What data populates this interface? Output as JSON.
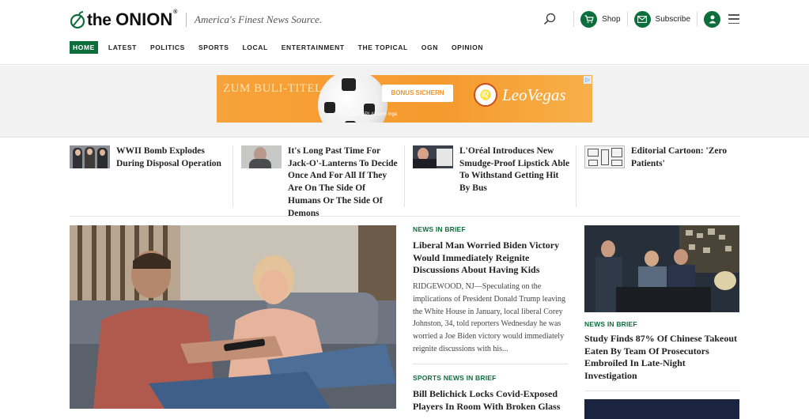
{
  "brand": {
    "logo_the": "the",
    "logo_onion": "ONION",
    "logo_reg": "®",
    "tagline": "America's Finest News Source.",
    "accent_color": "#0d6d3b"
  },
  "nav": {
    "items": [
      "HOME",
      "LATEST",
      "POLITICS",
      "SPORTS",
      "LOCAL",
      "ENTERTAINMENT",
      "THE TOPICAL",
      "OGN",
      "OPINION"
    ],
    "active": "HOME"
  },
  "header_actions": {
    "shop_label": "Shop",
    "subscribe_label": "Subscribe",
    "icons": [
      "search-icon",
      "cart-icon",
      "mail-icon",
      "user-icon",
      "menu-icon"
    ]
  },
  "ad": {
    "headline": "ZUM BULI-TITEL WETTEN",
    "button": "BONUS SICHERN",
    "brand": "LeoVegas",
    "footer": "LEOSAFEPLAY.com  mga"
  },
  "strip": [
    {
      "title": "WWII Bomb Explodes During Disposal Operation"
    },
    {
      "title": "It's Long Past Time For Jack-O'-Lanterns To Decide Once And For All If They Are On The Side Of Humans Or The Side Of Demons"
    },
    {
      "title": "L'Oréal Introduces New Smudge-Proof Lipstick Able To Withstand Getting Hit By Bus"
    },
    {
      "title": "Editorial Cartoon: 'Zero Patients'"
    }
  ],
  "center": {
    "kicker": "NEWS IN BRIEF",
    "headline": "Liberal Man Worried Biden Victory Would Immediately Reignite Discussions About Having Kids",
    "body": "RIDGEWOOD, NJ—Speculating on the implications of President Donald Trump leaving the White House in January, local liberal Corey Johnston, 34, told reporters Wednesday he was worried a Joe Biden victory would immediately reignite discussions with his...",
    "kicker2": "SPORTS NEWS IN BRIEF",
    "headline2": "Bill Belichick Locks Covid-Exposed Players In Room With Broken Glass"
  },
  "right": {
    "kicker": "NEWS IN BRIEF",
    "headline": "Study Finds 87% Of Chinese Takeout Eaten By Team Of Prosecutors Embroiled In Late-Night Investigation"
  }
}
